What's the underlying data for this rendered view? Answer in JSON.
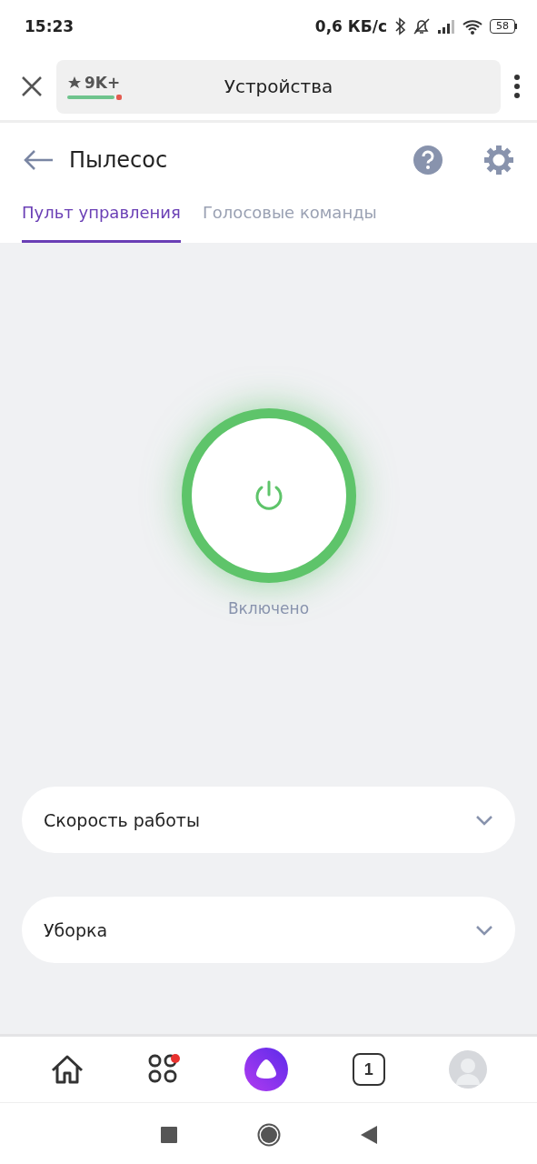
{
  "status_bar": {
    "time": "15:23",
    "speed": "0,6 КБ/с",
    "battery": "58"
  },
  "browser": {
    "rating": "9K+",
    "title": "Устройства"
  },
  "header": {
    "title": "Пылесос"
  },
  "tabs": [
    {
      "label": "Пульт управления",
      "selected": true
    },
    {
      "label": "Голосовые команды",
      "selected": false
    }
  ],
  "power": {
    "on": true,
    "label": "Включено"
  },
  "sections": [
    {
      "label": "Скорость работы"
    },
    {
      "label": "Уборка"
    }
  ],
  "bottom_nav": {
    "tabs_count": "1",
    "notification": true
  }
}
